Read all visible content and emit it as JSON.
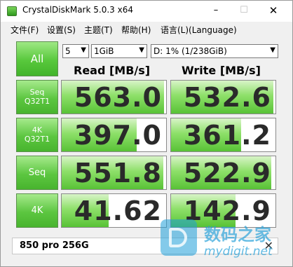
{
  "window": {
    "title": "CrystalDiskMark 5.0.3 x64",
    "controls": {
      "minimize": "–",
      "maximize": "☐",
      "close": "✕"
    }
  },
  "menu": [
    "文件(F)",
    "设置(S)",
    "主题(T)",
    "帮助(H)",
    "语言(L)(Language)"
  ],
  "toolbar": {
    "all_label": "All",
    "count_value": "5",
    "size_value": "1GiB",
    "drive_value": "D: 1% (1/238GiB)"
  },
  "headers": {
    "read": "Read [MB/s]",
    "write": "Write [MB/s]"
  },
  "rows": [
    {
      "label_line1": "Seq",
      "label_line2": "Q32T1",
      "read": "563.0",
      "write": "532.6",
      "read_fill": 0.98,
      "write_fill": 0.98
    },
    {
      "label_line1": "4K",
      "label_line2": "Q32T1",
      "read": "397.0",
      "write": "361.2",
      "read_fill": 0.72,
      "write_fill": 0.67
    },
    {
      "label_line1": "Seq",
      "label_line2": "",
      "read": "551.8",
      "write": "522.9",
      "read_fill": 0.97,
      "write_fill": 0.96
    },
    {
      "label_line1": "4K",
      "label_line2": "",
      "read": "41.62",
      "write": "142.9",
      "read_fill": 0.45,
      "write_fill": 0.62
    }
  ],
  "comment": {
    "value": "850 pro 256G",
    "close_icon": "✕"
  },
  "watermark": {
    "cn": "数码之家",
    "url": "mydigit.net"
  }
}
